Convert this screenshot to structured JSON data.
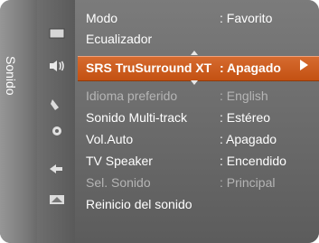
{
  "sidebar": {
    "label": "Sonido"
  },
  "menu": {
    "items": [
      {
        "label": "Modo",
        "value": ": Favorito"
      },
      {
        "label": "Ecualizador",
        "value": ""
      },
      {
        "label": "SRS TruSurround XT",
        "value": ": Apagado"
      },
      {
        "label": "Idioma preferido",
        "value": ": English"
      },
      {
        "label": "Sonido Multi-track",
        "value": ": Estéreo"
      },
      {
        "label": "Vol.Auto",
        "value": ": Apagado"
      },
      {
        "label": "TV Speaker",
        "value": ": Encendido"
      },
      {
        "label": "Sel. Sonido",
        "value": ": Principal"
      },
      {
        "label": "Reinicio del sonido",
        "value": ""
      }
    ]
  },
  "icons": [
    "picture-icon",
    "sound-icon",
    "channel-icon",
    "setup-icon",
    "input-icon",
    "application-icon"
  ]
}
